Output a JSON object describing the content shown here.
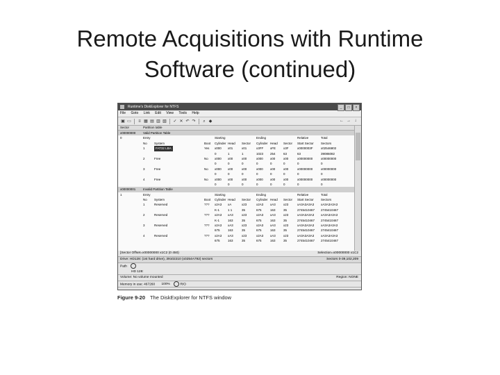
{
  "slide": {
    "title_line1": "Remote Acquisitions with Runtime",
    "title_line2": "Software (continued)"
  },
  "window": {
    "title": "Runtime's DiskExplorer for NTFS",
    "menu": [
      "File",
      "Goto",
      "Link",
      "Edit",
      "View",
      "Tools",
      "Help"
    ],
    "toolbar_icons": [
      "save-icon",
      "open-icon",
      "list-icon",
      "grid-icon",
      "hex-icon",
      "text-icon",
      "info-icon",
      "check-icon",
      "cancel-icon",
      "undo-icon",
      "redo-icon",
      "search-icon",
      "tag-icon",
      "back-icon",
      "forward-icon",
      "down-icon"
    ],
    "col_header": {
      "sector": "Sector",
      "partition_table": "Partition table"
    },
    "sections": [
      {
        "sector": "x00000000",
        "label": "Valid Partition Table",
        "entry_no": "0",
        "header_row1": {
          "entry": "Entry",
          "starting": "Starting",
          "ending": "Ending",
          "relative": "Relative",
          "total": "Total"
        },
        "header_row2": {
          "no": "No",
          "system": "System",
          "boot": "Boot",
          "cyl": "Cylinder",
          "head": "Head",
          "sector": "Sector",
          "cyl2": "Cylinder",
          "head2": "Head",
          "sector2": "Sector",
          "rel": "Start Sector",
          "total": "Sectors"
        },
        "rows": [
          [
            "1",
            "FAT32 LBA",
            "Yes",
            "x000",
            "x01",
            "x01",
            "x3FF",
            "xFE",
            "x3F",
            "x0000003F",
            "x02546802"
          ],
          [
            "",
            "",
            "",
            "0",
            "1",
            "1",
            "1023",
            "254",
            "63",
            "63",
            "39086082"
          ],
          [
            "2",
            "Free",
            "No",
            "x000",
            "x00",
            "x00",
            "x000",
            "x00",
            "x00",
            "x00000000",
            "x00000000"
          ],
          [
            "",
            "",
            "",
            "0",
            "0",
            "0",
            "0",
            "0",
            "0",
            "0",
            "0"
          ],
          [
            "3",
            "Free",
            "No",
            "x000",
            "x00",
            "x00",
            "x000",
            "x00",
            "x00",
            "x00000000",
            "x00000000"
          ],
          [
            "",
            "",
            "",
            "0",
            "0",
            "0",
            "0",
            "0",
            "0",
            "0",
            "0"
          ],
          [
            "4",
            "Free",
            "No",
            "x000",
            "x00",
            "x00",
            "x000",
            "x00",
            "x00",
            "x00000000",
            "x00000000"
          ],
          [
            "",
            "",
            "",
            "0",
            "0",
            "0",
            "0",
            "0",
            "0",
            "0",
            "0"
          ]
        ]
      },
      {
        "sector": "x00000001",
        "label": "Invalid Partition Table",
        "entry_no": "1",
        "header_row1": {
          "entry": "Entry",
          "starting": "Starting",
          "ending": "Ending",
          "relative": "Relative",
          "total": "Total"
        },
        "header_row2": {
          "no": "No",
          "system": "System",
          "boot": "Boot",
          "cyl": "Cylinder",
          "head": "Head",
          "sector": "Sector",
          "cyl2": "Cylinder",
          "head2": "Head",
          "sector2": "Sector",
          "rel": "Start Sector",
          "total": "Sectors"
        },
        "rows": [
          [
            "1",
            "Reserved",
            "???",
            "x2A3",
            "xA",
            "x23",
            "x2A3",
            "xA3",
            "x23",
            "xA3A3A3A3",
            "xA3A3A3A3"
          ],
          [
            "",
            "",
            "",
            "K-1",
            "1 1",
            "35",
            "675",
            "163",
            "35",
            "2745410467",
            "2745410467"
          ],
          [
            "2",
            "Reserved",
            "???",
            "x2A3",
            "xA3",
            "x23",
            "x2A3",
            "xA3",
            "x23",
            "xA3A3A3A3",
            "xA3A3A3A3"
          ],
          [
            "",
            "",
            "",
            "K-1",
            "163",
            "35",
            "675",
            "163",
            "35",
            "2745410467",
            "2745410467"
          ],
          [
            "3",
            "Reserved",
            "???",
            "x2A3",
            "xA3",
            "x23",
            "x2A3",
            "xA3",
            "x23",
            "xA3A3A3A3",
            "xA3A3A3A3"
          ],
          [
            "",
            "",
            "",
            "675",
            "163",
            "35",
            "675",
            "163",
            "35",
            "2745410467",
            "2745410467"
          ],
          [
            "4",
            "Reserved",
            "???",
            "x2A3",
            "xA3",
            "x23",
            "x2A3",
            "xA3",
            "x23",
            "xA3A3A3A3",
            "xA3A3A3A3"
          ],
          [
            "",
            "",
            "",
            "675",
            "163",
            "35",
            "675",
            "163",
            "35",
            "2745410467",
            "2745410467"
          ]
        ]
      }
    ],
    "status": {
      "offset": "[Sector Offset=x00000000 x1C2 (0 450)",
      "selection": "Selection=x00000000 x1C2",
      "drive": "Drive: HD128: (1st hard drive), 39102210 (x0254A792) sectors",
      "drive_range": "Sectors 0-39,102,209",
      "path_label": "Path",
      "path_value": "HD 128:",
      "volume": "Volume: No volume mounted",
      "region": "Region: NONE",
      "memory": "Memory in use: 467260",
      "extra": "100%",
      "mode": "R/O"
    }
  },
  "caption": {
    "figure": "Figure 9-20",
    "text": "The DiskExplorer for NTFS window"
  }
}
